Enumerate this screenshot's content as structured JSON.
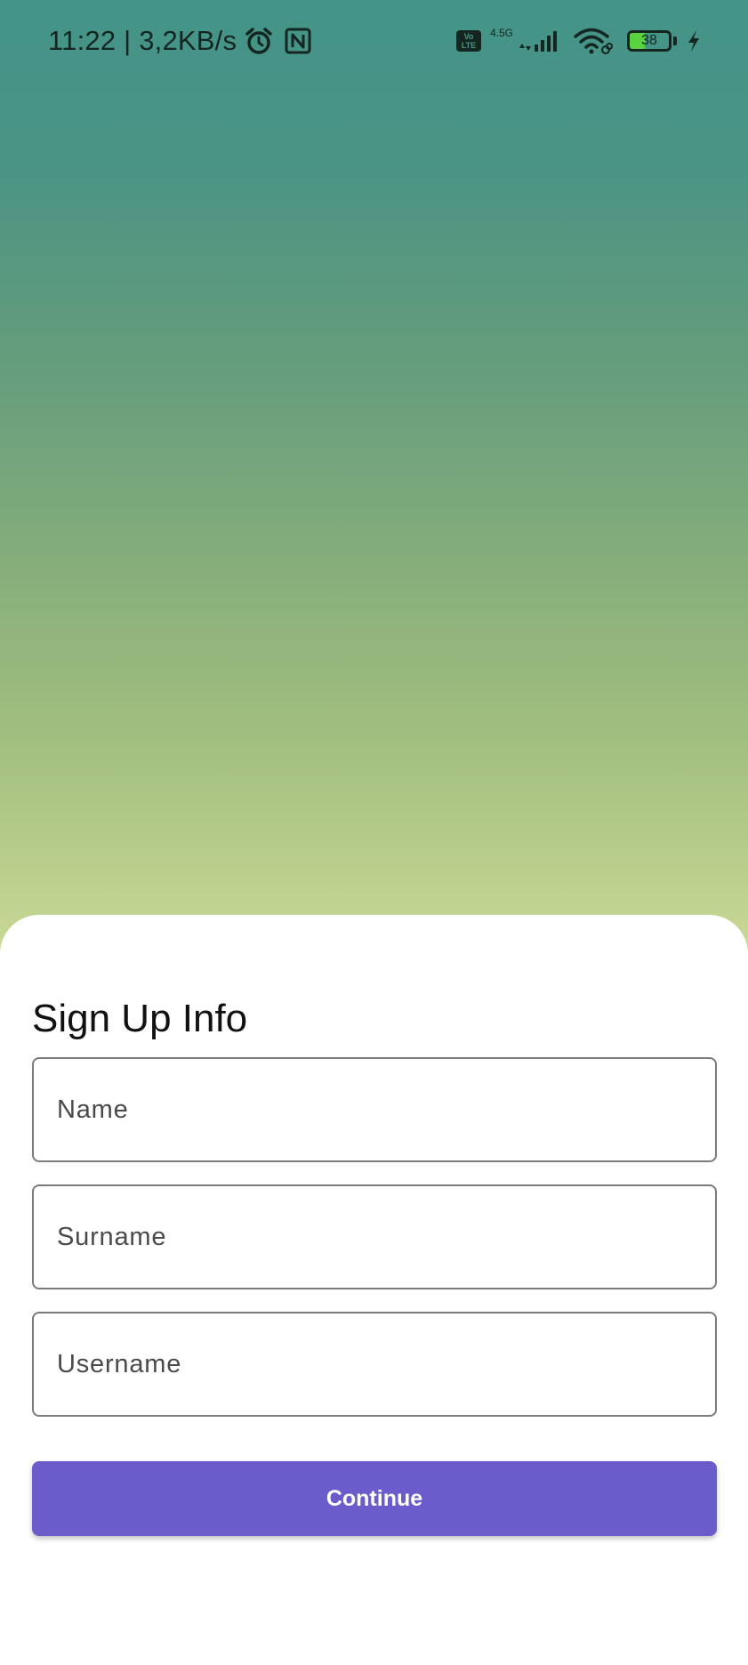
{
  "status_bar": {
    "time": "11:22",
    "separator": "|",
    "speed": "3,2KB/s",
    "alarm_icon": "alarm-clock-icon",
    "nfc_icon": "nfc-icon",
    "volte_line1": "Vo",
    "volte_line2": "LTE",
    "network_type": "4.5G",
    "signal_icon": "cell-signal-icon",
    "wifi_icon": "wifi-icon",
    "battery_level": "38",
    "battery_fraction": 0.38,
    "charging_icon": "lightning-bolt-icon"
  },
  "colors": {
    "accent": "#6a5ccb",
    "gradient_top": "#449489",
    "gradient_bottom": "#d2df9a",
    "battery_fill": "#58d241"
  },
  "sheet": {
    "title": "Sign Up Info",
    "fields": {
      "name_placeholder": "Name",
      "name_value": "",
      "surname_placeholder": "Surname",
      "surname_value": "",
      "username_placeholder": "Username",
      "username_value": ""
    },
    "continue_label": "Continue"
  }
}
